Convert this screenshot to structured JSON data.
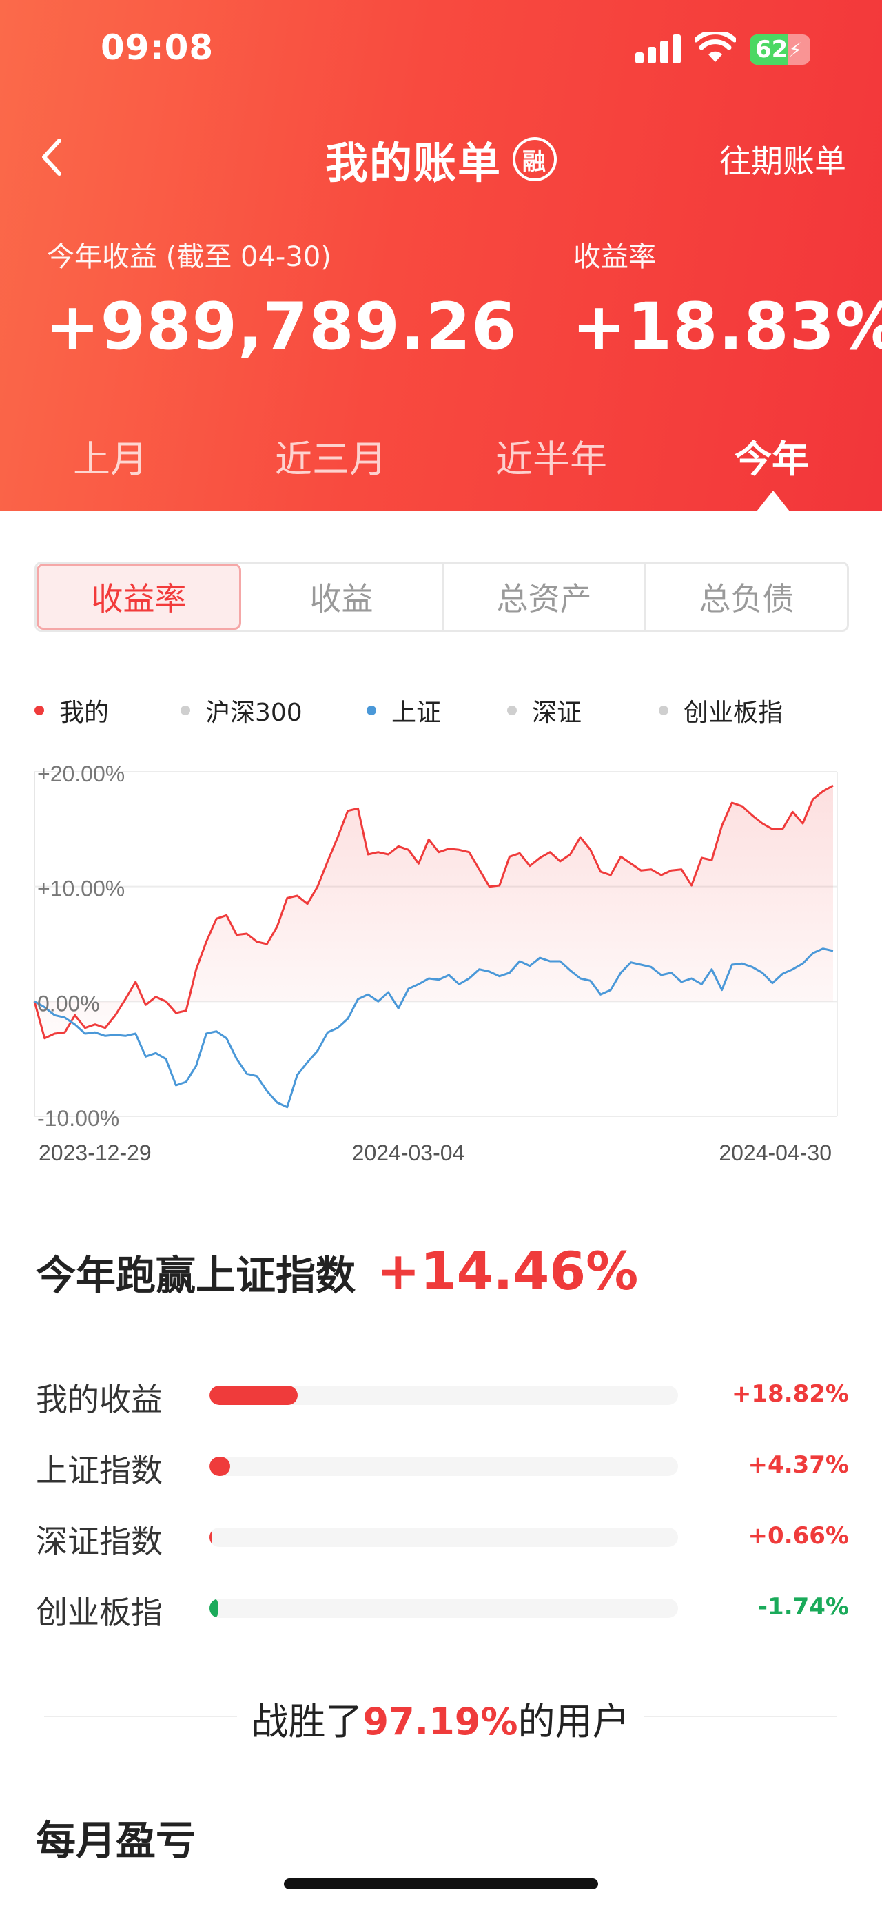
{
  "status_bar": {
    "time": "09:08",
    "battery": "62"
  },
  "nav": {
    "title": "我的账单",
    "badge": "融",
    "history_label": "往期账单"
  },
  "summary": {
    "income_label": "今年收益 (截至 04-30)",
    "income_value": "+989,789.26",
    "rate_label": "收益率",
    "rate_value": "+18.83%"
  },
  "periods": [
    {
      "label": "上月",
      "active": false
    },
    {
      "label": "近三月",
      "active": false
    },
    {
      "label": "近半年",
      "active": false
    },
    {
      "label": "今年",
      "active": true
    }
  ],
  "metric_tabs": [
    {
      "label": "收益率",
      "active": true
    },
    {
      "label": "收益",
      "active": false
    },
    {
      "label": "总资产",
      "active": false
    },
    {
      "label": "总负债",
      "active": false
    }
  ],
  "legend": [
    {
      "name": "我的",
      "color": "#ef3b3b"
    },
    {
      "name": "沪深300",
      "color": "#cfcfcf"
    },
    {
      "name": "上证",
      "color": "#4a98d8"
    },
    {
      "name": "深证",
      "color": "#cfcfcf"
    },
    {
      "name": "创业板指",
      "color": "#cfcfcf"
    }
  ],
  "chart_data": {
    "type": "line",
    "y_ticks": [
      "+20.00%",
      "+10.00%",
      "0.00%",
      "-10.00%"
    ],
    "ylim": [
      -10,
      20
    ],
    "x_ticks": [
      "2023-12-29",
      "2024-03-04",
      "2024-04-30"
    ],
    "series": [
      {
        "name": "我的",
        "color": "#ef3b3b",
        "values": [
          0,
          -3.2,
          -2.8,
          -2.7,
          -1.2,
          -2.3,
          -2.0,
          -2.3,
          -1.2,
          0.2,
          1.7,
          -0.3,
          0.4,
          0,
          -1.0,
          -0.8,
          2.8,
          5.2,
          7.2,
          7.5,
          5.8,
          5.9,
          5.2,
          5.0,
          6.5,
          9.0,
          9.2,
          8.5,
          10.0,
          12.2,
          14.3,
          16.6,
          16.8,
          12.8,
          13.0,
          12.8,
          13.5,
          13.2,
          12.0,
          14.1,
          13.0,
          13.3,
          13.2,
          13.0,
          11.5,
          10.0,
          10.1,
          12.6,
          12.9,
          11.8,
          12.5,
          13.0,
          12.2,
          12.8,
          14.3,
          13.2,
          11.3,
          11.0,
          12.6,
          12.0,
          11.4,
          11.5,
          11.0,
          11.4,
          11.5,
          10.1,
          12.5,
          12.3,
          15.3,
          17.3,
          17.0,
          16.2,
          15.5,
          15.0,
          15.0,
          16.5,
          15.5,
          17.6,
          18.3,
          18.8
        ]
      },
      {
        "name": "上证",
        "color": "#4a98d8",
        "values": [
          0,
          -0.5,
          -1.2,
          -1.4,
          -2.0,
          -2.8,
          -2.7,
          -3.0,
          -2.9,
          -3.0,
          -2.8,
          -4.8,
          -4.5,
          -5.0,
          -7.3,
          -7.0,
          -5.6,
          -2.8,
          -2.6,
          -3.2,
          -5.0,
          -6.3,
          -6.5,
          -7.8,
          -8.8,
          -9.2,
          -6.4,
          -5.3,
          -4.3,
          -2.7,
          -2.3,
          -1.5,
          0.2,
          0.6,
          0,
          0.8,
          -0.6,
          1.1,
          1.5,
          2.0,
          1.9,
          2.3,
          1.5,
          2.0,
          2.8,
          2.6,
          2.2,
          2.5,
          3.5,
          3.1,
          3.8,
          3.5,
          3.5,
          2.7,
          2.0,
          1.8,
          0.6,
          1.0,
          2.5,
          3.4,
          3.2,
          3.0,
          2.3,
          2.5,
          1.7,
          2.0,
          1.5,
          2.8,
          1.0,
          3.2,
          3.3,
          3.0,
          2.5,
          1.6,
          2.4,
          2.8,
          3.3,
          4.2,
          4.6,
          4.4
        ]
      }
    ]
  },
  "beat": {
    "label": "今年跑赢上证指数",
    "value": "+14.46%"
  },
  "comparison": [
    {
      "name": "我的收益",
      "value": "+18.82%",
      "fraction": 0.188,
      "color": "#ef3b3b"
    },
    {
      "name": "上证指数",
      "value": "+4.37%",
      "fraction": 0.044,
      "color": "#ef3b3b"
    },
    {
      "name": "深证指数",
      "value": "+0.66%",
      "fraction": 0.007,
      "color": "#ef3b3b"
    },
    {
      "name": "创业板指",
      "value": "-1.74%",
      "fraction": 0.017,
      "color": "#1aaa5a"
    }
  ],
  "win": {
    "prefix": "战胜了",
    "percent": "97.19%",
    "suffix": "的用户"
  },
  "monthly_title": "每月盈亏"
}
